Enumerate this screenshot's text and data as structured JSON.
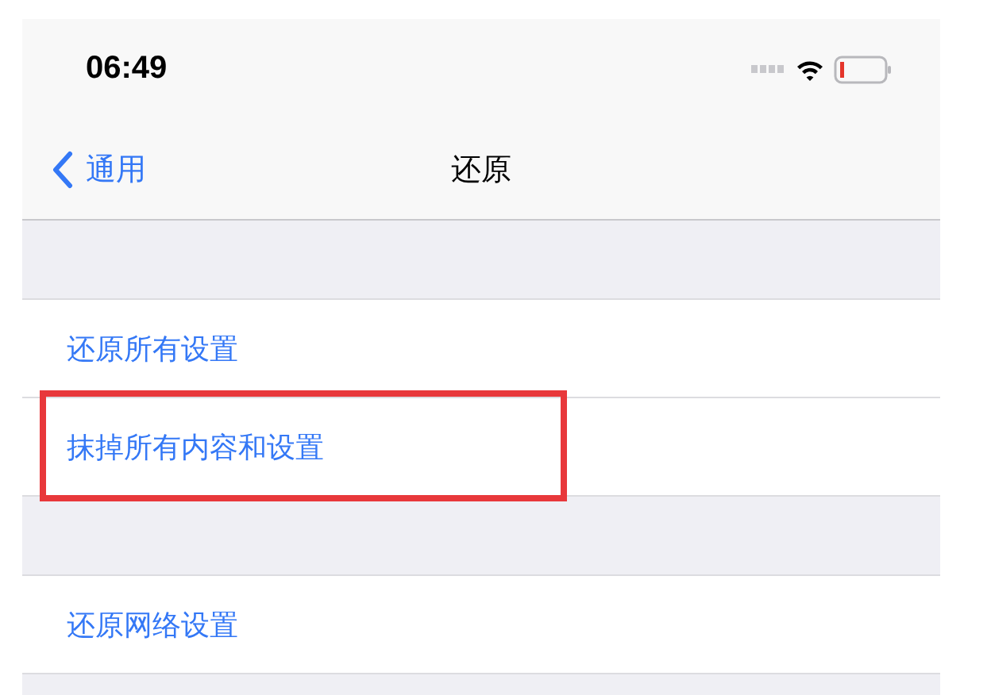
{
  "status_bar": {
    "time": "06:49"
  },
  "nav_bar": {
    "back": "通用",
    "title": "还原"
  },
  "sections": [
    {
      "items": [
        {
          "label": "还原所有设置",
          "highlighted": false
        },
        {
          "label": "抹掉所有内容和设置",
          "highlighted": true
        }
      ]
    },
    {
      "items": [
        {
          "label": "还原网络设置",
          "highlighted": false
        }
      ]
    }
  ]
}
